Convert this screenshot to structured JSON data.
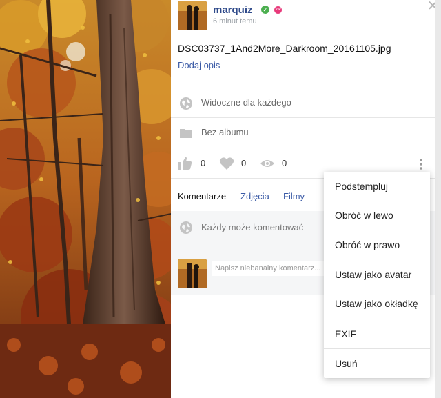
{
  "post": {
    "username": "marquiz",
    "verified_icon": "check-circle-icon",
    "vip_badge": "VIP",
    "time": "6 minut temu",
    "filename": "DSC03737_1And2More_Darkroom_20161105.jpg",
    "add_description": "Dodaj opis"
  },
  "details": {
    "visibility": "Widoczne dla każdego",
    "album": "Bez albumu"
  },
  "stats": {
    "likes": "0",
    "hearts": "0",
    "views": "0"
  },
  "tabs": [
    {
      "label": "Komentarze",
      "active": true
    },
    {
      "label": "Zdjęcia",
      "active": false
    },
    {
      "label": "Filmy",
      "active": false
    }
  ],
  "comments": {
    "permission": "Każdy może komentować",
    "placeholder": "Napisz niebanalny komentarz..."
  },
  "menu": {
    "items": [
      "Podstempluj",
      "Obróć w lewo",
      "Obróć w prawo",
      "Ustaw jako avatar",
      "Ustaw jako okładkę",
      "EXIF",
      "Usuń"
    ]
  },
  "colors": {
    "link": "#3a5aa6",
    "username": "#2f4a8a",
    "verified": "#4caf50",
    "vip": "#e8397a",
    "icon_grey": "#c4c4c4"
  }
}
